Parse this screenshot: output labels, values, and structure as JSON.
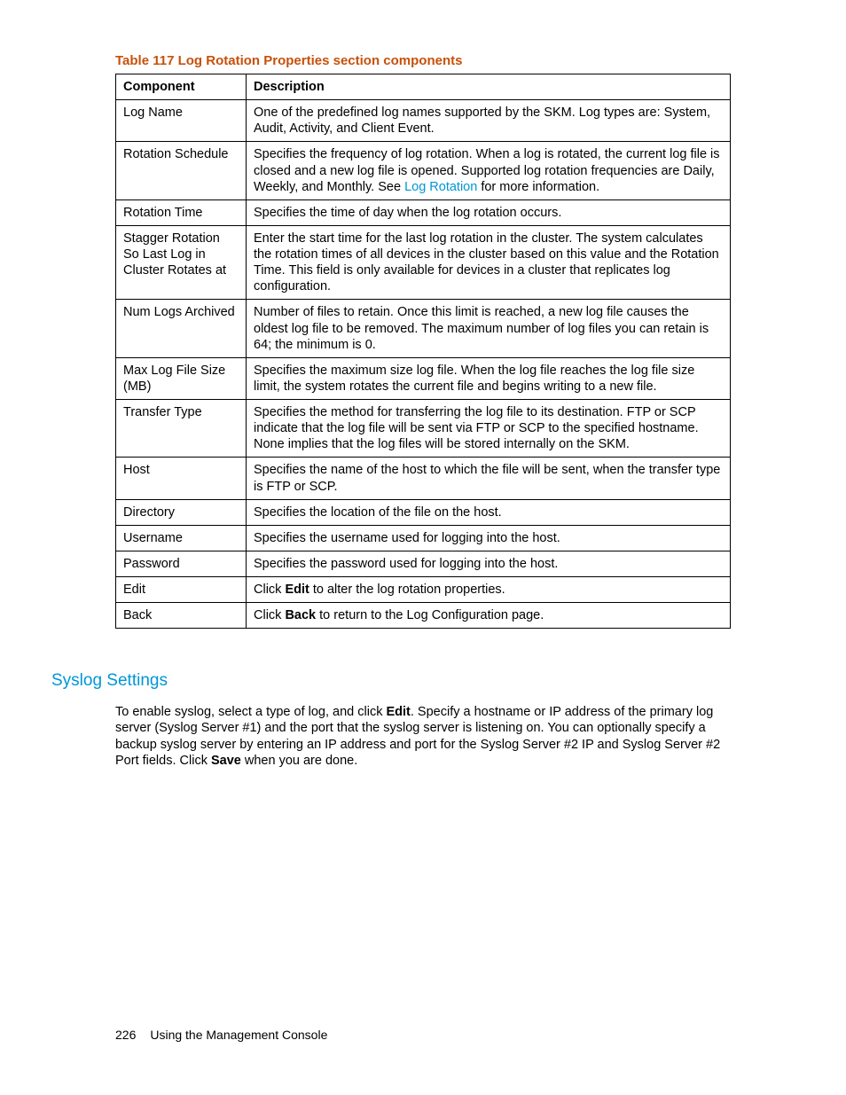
{
  "table": {
    "caption": "Table 117 Log Rotation Properties section components",
    "headers": [
      "Component",
      "Description"
    ],
    "rows": [
      {
        "component": "Log Name",
        "description": "One of the predefined log names supported by the SKM. Log types are: System, Audit, Activity, and Client Event."
      },
      {
        "component": "Rotation Schedule",
        "desc_pre": "Specifies the frequency of log rotation. When a log is rotated, the current log file is closed and a new log file is opened. Supported log rotation frequencies are Daily, Weekly, and Monthly. See ",
        "desc_link": "Log Rotation",
        "desc_post": " for more information."
      },
      {
        "component": "Rotation Time",
        "description": "Specifies the time of day when the log rotation occurs."
      },
      {
        "component": "Stagger Rotation So Last Log in Cluster Rotates at",
        "description": "Enter the start time for the last log rotation in the cluster. The system calculates the rotation times of all devices in the cluster based on this value and the Rotation Time. This field is only available for devices in a cluster that replicates log configuration."
      },
      {
        "component": "Num Logs Archived",
        "description": "Number of files to retain. Once this limit is reached, a new log file causes the oldest log file to be removed. The maximum number of log files you can retain is 64; the minimum is 0."
      },
      {
        "component": "Max Log File Size (MB)",
        "description": "Specifies the maximum size log file. When the log file reaches the log file size limit, the system rotates the current file and begins writing to a new file."
      },
      {
        "component": "Transfer Type",
        "description": "Specifies the method for transferring the log file to its destination. FTP or SCP indicate that the log file will be sent via FTP or SCP to the specified hostname. None implies that the log files will be stored internally on the SKM."
      },
      {
        "component": "Host",
        "description": "Specifies the name of the host to which the file will be sent, when the transfer type is FTP or SCP."
      },
      {
        "component": "Directory",
        "description": "Specifies the location of the file on the host."
      },
      {
        "component": "Username",
        "description": "Specifies the username used for logging into the host."
      },
      {
        "component": "Password",
        "description": "Specifies the password used for logging into the host."
      },
      {
        "component": "Edit",
        "desc_pre": "Click ",
        "desc_bold": "Edit",
        "desc_post": " to alter the log rotation properties."
      },
      {
        "component": "Back",
        "desc_pre": "Click ",
        "desc_bold": "Back",
        "desc_post": " to return to the Log Configuration page."
      }
    ]
  },
  "section": {
    "heading": "Syslog Settings",
    "para_pre": "To enable syslog, select a type of log, and click ",
    "para_b1": "Edit",
    "para_mid": ". Specify a hostname or IP address of the primary log server (Syslog Server #1) and the port that the syslog server is listening on. You can optionally specify a backup syslog server by entering an IP address and port for the Syslog Server #2 IP and Syslog Server #2 Port fields. Click ",
    "para_b2": "Save",
    "para_post": " when you are done."
  },
  "footer": {
    "page": "226",
    "title": "Using the Management Console"
  }
}
